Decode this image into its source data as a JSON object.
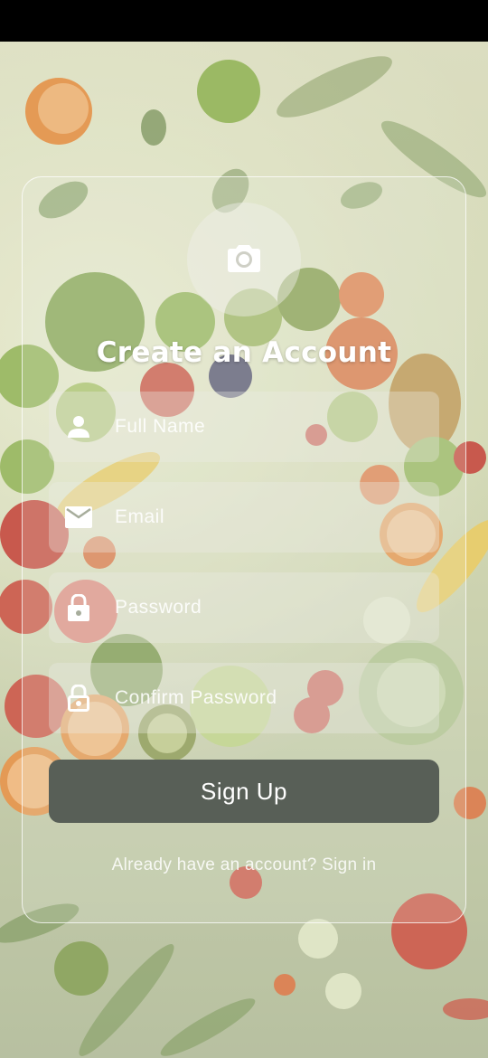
{
  "form": {
    "title": "Create an Account",
    "fields": [
      {
        "label": "Full Name",
        "icon": "person-icon"
      },
      {
        "label": "Email",
        "icon": "email-icon"
      },
      {
        "label": "Password",
        "icon": "lock-icon"
      },
      {
        "label": "Confirm Password",
        "icon": "lock-open-icon"
      }
    ],
    "signup_label": "Sign Up",
    "signin_text": "Already have an account? Sign in",
    "avatar_icon": "camera-icon"
  },
  "colors": {
    "button": "#585f57",
    "text": "#ffffff",
    "background": "#cfd6b4"
  }
}
